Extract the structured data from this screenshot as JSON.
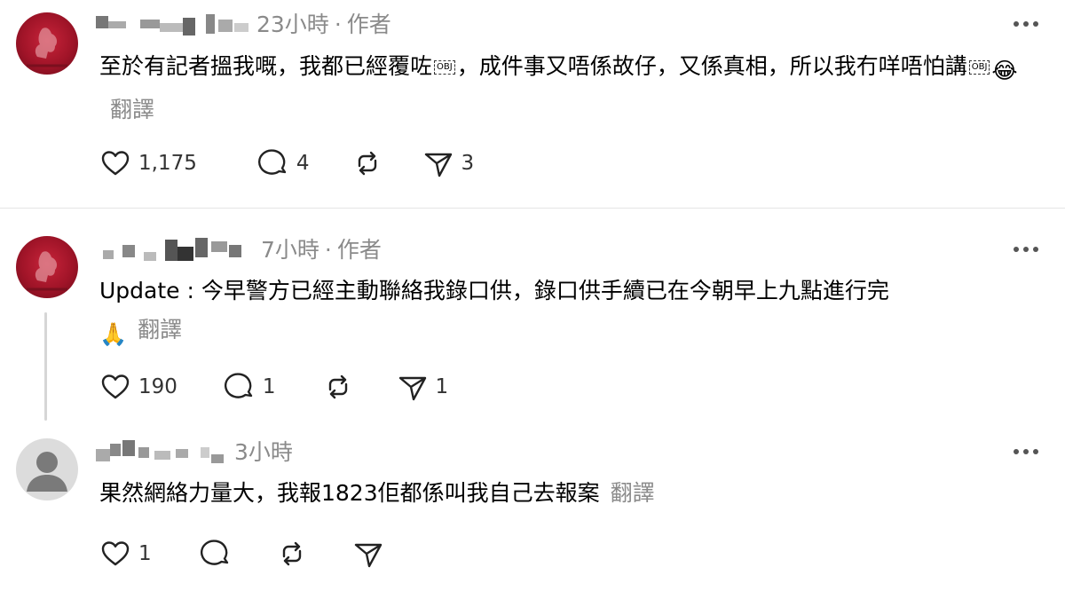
{
  "posts": [
    {
      "time": "23小時",
      "separator": "·",
      "role": "作者",
      "text": "至於有記者搵我嘅，我都已經覆咗",
      "text2": "，成件事又唔係故仔，又係真相，所以我冇咩唔怕講",
      "obj": "OBJ",
      "emoji": "😂",
      "translate": "翻譯",
      "likes": "1,175",
      "comments": "4",
      "reposts": "",
      "shares": "3"
    },
    {
      "time": "7小時",
      "separator": "·",
      "role": "作者",
      "text": "Update : 今早警方已經主動聯絡我錄口供，錄口供手續已在今朝早上九點進行完",
      "emoji": "🙏",
      "translate": "翻譯",
      "likes": "190",
      "comments": "1",
      "reposts": "",
      "shares": "1"
    },
    {
      "time": "3小時",
      "text": "果然網絡力量大，我報1823佢都係叫我自己去報案",
      "translate": "翻譯",
      "likes": "1",
      "comments": "",
      "reposts": "",
      "shares": ""
    }
  ],
  "icons": [
    "heart-icon",
    "comment-icon",
    "repost-icon",
    "share-icon",
    "more-icon"
  ],
  "colors": {
    "meta_gray": "#8a8a8a",
    "crest_red": "#a01428",
    "divider": "#e4e4e4"
  }
}
